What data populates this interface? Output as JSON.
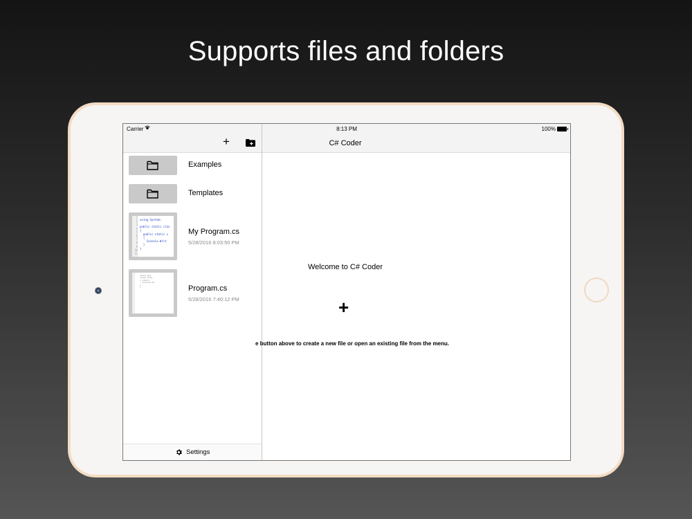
{
  "headline": "Supports files and folders",
  "status_bar": {
    "carrier": "Carrier",
    "time": "8:13 PM",
    "battery": "100%"
  },
  "sidebar": {
    "toolbar": {
      "add_icon": "plus-icon",
      "new_folder_icon": "folder-plus-icon"
    },
    "items": [
      {
        "type": "folder",
        "name": "Examples",
        "icon": "folder-icon"
      },
      {
        "type": "folder",
        "name": "Templates",
        "icon": "folder-icon"
      },
      {
        "type": "file",
        "name": "My Program.cs",
        "date": "5/28/2016 8:03:50 PM"
      },
      {
        "type": "file",
        "name": "Program.cs",
        "date": "5/28/2016 7:40:12 PM"
      }
    ],
    "settings_label": "Settings"
  },
  "detail": {
    "title": "C# Coder",
    "welcome": "Welcome to C# Coder",
    "add_symbol": "+",
    "hint": "e button above to create a new file or open an existing file from the menu."
  },
  "colors": {
    "frame_border": "#f3dcc4",
    "bar_background": "#f3f3f3",
    "thumb_background": "#c9c9c9"
  }
}
